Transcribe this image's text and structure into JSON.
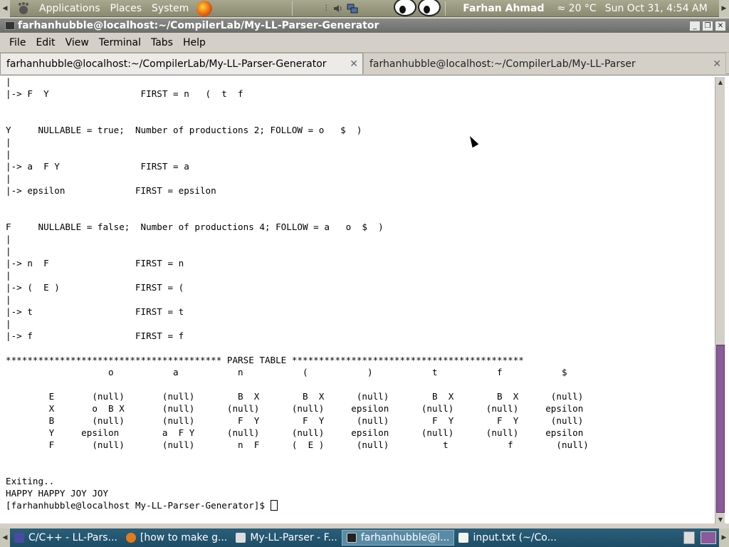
{
  "top_panel": {
    "menus": [
      "Applications",
      "Places",
      "System"
    ],
    "user": "Farhan Ahmad",
    "weather": "20 °C",
    "clock": "Sun Oct 31,  4:54 AM"
  },
  "window": {
    "title": "farhanhubble@localhost:~/CompilerLab/My-LL-Parser-Generator",
    "menu": [
      "File",
      "Edit",
      "View",
      "Terminal",
      "Tabs",
      "Help"
    ],
    "tabs": [
      {
        "label": "farhanhubble@localhost:~/CompilerLab/My-LL-Parser-Generator",
        "active": true
      },
      {
        "label": "farhanhubble@localhost:~/CompilerLab/My-LL-Parser",
        "active": false
      }
    ]
  },
  "terminal": {
    "lines": [
      "|",
      "|-> F  Y                 FIRST = n   (  t  f",
      "",
      "",
      "Y     NULLABLE = true;  Number of productions 2; FOLLOW = o   $  )",
      "|",
      "|",
      "|-> a  F Y               FIRST = a",
      "|",
      "|-> epsilon             FIRST = epsilon",
      "",
      "",
      "F     NULLABLE = false;  Number of productions 4; FOLLOW = a   o  $  )",
      "|",
      "|",
      "|-> n  F                FIRST = n",
      "|",
      "|-> (  E )              FIRST = (",
      "|",
      "|-> t                   FIRST = t",
      "|",
      "|-> f                   FIRST = f",
      "",
      "**************************************** PARSE TABLE *******************************************",
      "                   o           a           n           (           )           t           f           $",
      "",
      "        E       (null)       (null)        B  X        B  X      (null)        B  X        B  X      (null)",
      "        X       o  B X       (null)      (null)      (null)     epsilon      (null)      (null)     epsilon",
      "        B       (null)       (null)        F  Y        F  Y      (null)        F  Y        F  Y      (null)",
      "        Y     epsilon        a  F Y      (null)      (null)     epsilon      (null)      (null)     epsilon",
      "        F       (null)       (null)        n  F      (  E )      (null)          t           f        (null)",
      "",
      "",
      "Exiting..",
      "HAPPY HAPPY JOY JOY"
    ],
    "prompt": "[farhanhubble@localhost My-LL-Parser-Generator]$ "
  },
  "taskbar": {
    "tasks": [
      {
        "label": "C/C++ - LL-Pars...",
        "active": false
      },
      {
        "label": "[how to make g...",
        "active": false
      },
      {
        "label": "My-LL-Parser - F...",
        "active": false
      },
      {
        "label": "farhanhubble@l...",
        "active": true
      },
      {
        "label": "input.txt (~/Co...",
        "active": false
      }
    ]
  }
}
